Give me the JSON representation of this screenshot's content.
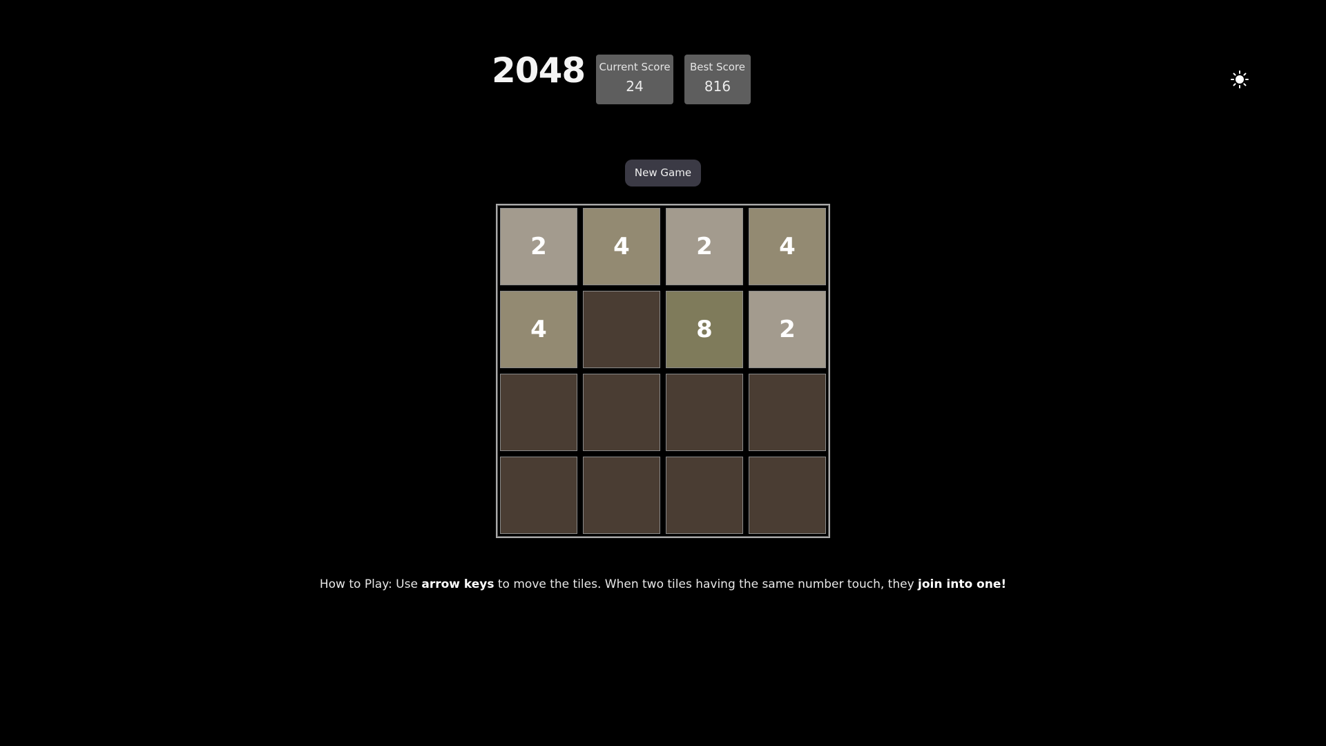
{
  "title": "2048",
  "scores": {
    "current_label": "Current Score",
    "current_value": "24",
    "best_label": "Best Score",
    "best_value": "816"
  },
  "theme_toggle": {
    "icon": "sun-icon"
  },
  "new_game_label": "New Game",
  "board": {
    "rows": [
      [
        "2",
        "4",
        "2",
        "4"
      ],
      [
        "4",
        "",
        "8",
        "2"
      ],
      [
        "",
        "",
        "",
        ""
      ],
      [
        "",
        "",
        "",
        ""
      ]
    ],
    "tile_colors": {
      "empty": "#4a3d33",
      "2": "#a39b8e",
      "4": "#938a72",
      "8": "#7f7b5b"
    }
  },
  "instructions": {
    "prefix": "How to Play: Use ",
    "bold1": "arrow keys",
    "middle": " to move the tiles. When two tiles having the same number touch, they ",
    "bold2": "join into one!"
  }
}
